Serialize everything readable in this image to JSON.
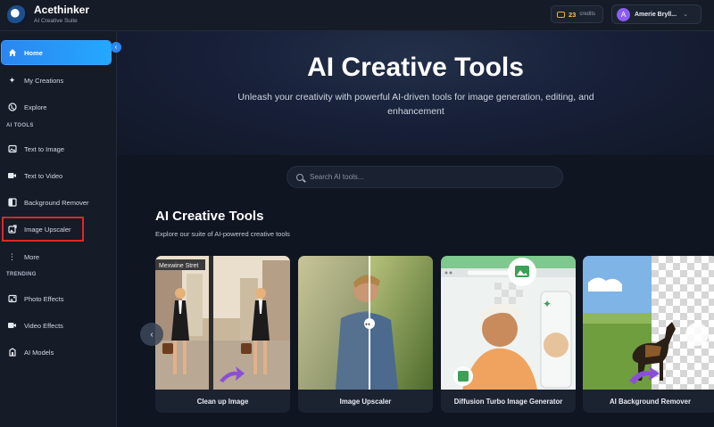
{
  "topbar": {
    "brand": "Acethinker",
    "brand_sub": "AI Creative Suite",
    "credits_count": "23",
    "credits_label": "credits",
    "user_initial": "A",
    "user_name": "Amerie Bryll..."
  },
  "sidebar": {
    "items_main": [
      {
        "label": "Home",
        "icon": "home-icon",
        "active": true
      },
      {
        "label": "My Creations",
        "icon": "sparkle-icon"
      },
      {
        "label": "Explore",
        "icon": "globe-icon"
      }
    ],
    "section_ai_tools": "AI TOOLS",
    "items_tools": [
      {
        "label": "Text to Image",
        "icon": "image-icon"
      },
      {
        "label": "Text to Video",
        "icon": "video-icon"
      },
      {
        "label": "Background Remover",
        "icon": "background-remover-icon"
      },
      {
        "label": "Image Upscaler",
        "icon": "upscale-icon"
      },
      {
        "label": "More",
        "icon": "more-dots-icon"
      }
    ],
    "section_trending": "TRENDING",
    "items_trending": [
      {
        "label": "Photo Effects",
        "icon": "photo-effects-icon"
      },
      {
        "label": "Video Effects",
        "icon": "video-effects-icon"
      },
      {
        "label": "AI Models",
        "icon": "ai-models-icon"
      }
    ]
  },
  "hero": {
    "title": "AI Creative Tools",
    "subtitle": "Unleash your creativity with powerful AI-driven tools for image generation, editing, and enhancement"
  },
  "search": {
    "placeholder": "Search AI tools..."
  },
  "tools_section": {
    "title": "AI Creative Tools",
    "subtitle": "Explore our suite of AI-powered creative tools",
    "street_sign": "Mexwine Stret",
    "cards": [
      {
        "label": "Clean up Image"
      },
      {
        "label": "Image Upscaler"
      },
      {
        "label": "Diffusion Turbo Image Generator"
      },
      {
        "label": "AI Background Remover"
      }
    ]
  },
  "colors": {
    "accent": "#2b86f0",
    "highlight": "#e0262a",
    "credits": "#f2c94c"
  }
}
